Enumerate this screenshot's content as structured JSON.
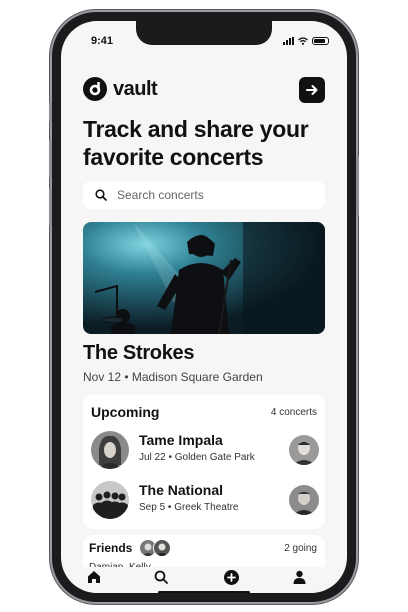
{
  "status": {
    "time": "9:41"
  },
  "app": {
    "name": "vault"
  },
  "headline": "Track and share your favorite concerts",
  "search": {
    "placeholder": "Search concerts"
  },
  "featured": {
    "title": "The Strokes",
    "subtitle": "Nov 12 • Madison Square Garden"
  },
  "upcoming": {
    "heading": "Upcoming",
    "count": "4 concerts",
    "items": [
      {
        "title": "Tame Impala",
        "subtitle": "Jul 22 • Golden Gate Park"
      },
      {
        "title": "The National",
        "subtitle": "Sep 5 • Greek Theatre"
      }
    ]
  },
  "friends": {
    "heading": "Friends",
    "names": "Damian, Kelly",
    "going": "2 going"
  },
  "tabs": [
    "home-icon",
    "search-icon",
    "add-icon",
    "profile-icon"
  ],
  "colors": {
    "accent": "#111111",
    "background": "#f6f6f6",
    "hero_light": "#4fb3c9"
  }
}
